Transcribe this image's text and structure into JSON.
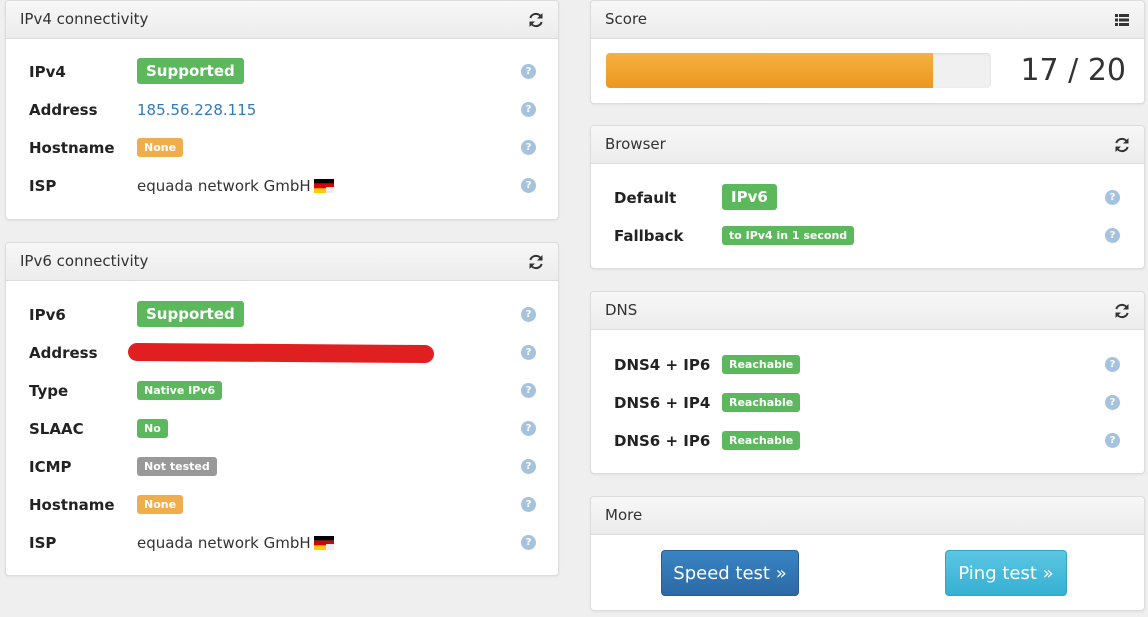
{
  "ipv4": {
    "title": "IPv4 connectivity",
    "rows": [
      {
        "label": "IPv4",
        "value": "Supported"
      },
      {
        "label": "Address",
        "value": "185.56.228.115"
      },
      {
        "label": "Hostname",
        "value": "None"
      },
      {
        "label": "ISP",
        "value": "equada network GmbH"
      }
    ]
  },
  "ipv6": {
    "title": "IPv6 connectivity",
    "rows": [
      {
        "label": "IPv6",
        "value": "Supported"
      },
      {
        "label": "Address",
        "value": ""
      },
      {
        "label": "Type",
        "value": "Native IPv6"
      },
      {
        "label": "SLAAC",
        "value": "No"
      },
      {
        "label": "ICMP",
        "value": "Not tested"
      },
      {
        "label": "Hostname",
        "value": "None"
      },
      {
        "label": "ISP",
        "value": "equada network GmbH"
      }
    ]
  },
  "score": {
    "title": "Score",
    "text": "17 / 20",
    "fraction": 0.85
  },
  "browser": {
    "title": "Browser",
    "rows": [
      {
        "label": "Default",
        "value": "IPv6"
      },
      {
        "label": "Fallback",
        "value": "to IPv4 in 1 second"
      }
    ]
  },
  "dns": {
    "title": "DNS",
    "rows": [
      {
        "label": "DNS4 + IP6",
        "value": "Reachable"
      },
      {
        "label": "DNS6 + IP4",
        "value": "Reachable"
      },
      {
        "label": "DNS6 + IP6",
        "value": "Reachable"
      }
    ]
  },
  "more": {
    "title": "More",
    "speed_test": "Speed test »",
    "ping_test": "Ping test »"
  },
  "help_glyph": "?",
  "colors": {
    "success": "#5cb85c",
    "warning": "#f0ad4e",
    "muted": "#999999",
    "primary": "#337ab7",
    "info": "#5bc0de",
    "redaction": "#e02020"
  }
}
